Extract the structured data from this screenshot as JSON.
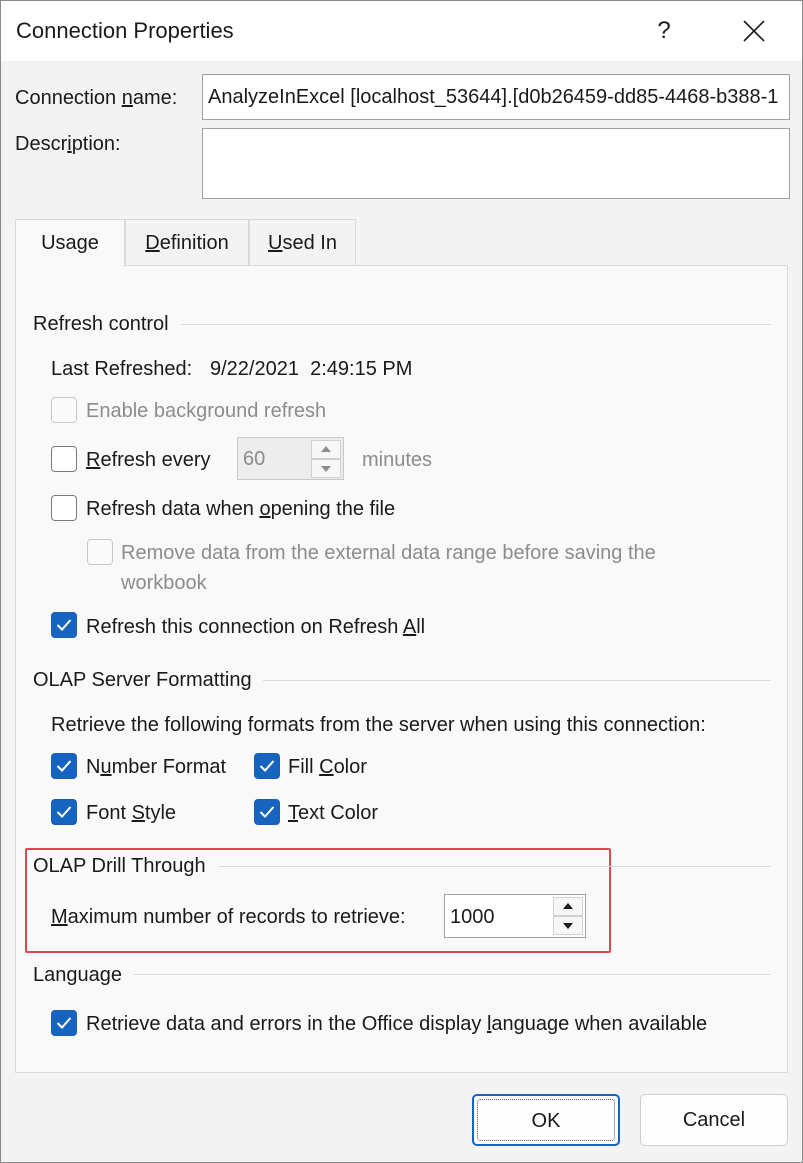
{
  "title": "Connection Properties",
  "titlebar": {
    "help_label": "?"
  },
  "fields": {
    "connection_name_label_pre": "Connection ",
    "connection_name_label_ul": "n",
    "connection_name_label_post": "ame:",
    "connection_name_value": "AnalyzeInExcel [localhost_53644].[d0b26459-dd85-4468-b388-1",
    "description_label_pre": "Descr",
    "description_label_ul": "i",
    "description_label_post": "ption:",
    "description_value": ""
  },
  "tabs": {
    "usage": "Usage",
    "definition_ul": "D",
    "definition_rest": "efinition",
    "used_in_ul": "U",
    "used_in_rest": "sed In"
  },
  "refresh_control": {
    "heading": "Refresh control",
    "last_refreshed_label": "Last Refreshed:",
    "last_refreshed_value": "9/22/2021  2:49:15 PM",
    "enable_background": "Enable background refresh",
    "refresh_every_ul": "R",
    "refresh_every_rest": "efresh every",
    "refresh_every_value": "60",
    "minutes": "minutes",
    "refresh_on_open_pre": "Refresh data when ",
    "refresh_on_open_ul": "o",
    "refresh_on_open_post": "pening the file",
    "remove_data_line1": "Remove data from the external data range before saving the",
    "remove_data_line2": "workbook",
    "refresh_all_pre": "Refresh this connection on Refresh ",
    "refresh_all_ul": "A",
    "refresh_all_post": "ll"
  },
  "olap_formatting": {
    "heading": "OLAP Server Formatting",
    "description": "Retrieve the following formats from the server when using this connection:",
    "number_format_pre": "N",
    "number_format_ul": "u",
    "number_format_post": "mber Format",
    "fill_color_pre": "Fill ",
    "fill_color_ul": "C",
    "fill_color_post": "olor",
    "font_style_pre": "Font ",
    "font_style_ul": "S",
    "font_style_post": "tyle",
    "text_color_ul": "T",
    "text_color_post": "ext Color"
  },
  "olap_drill": {
    "heading": "OLAP Drill Through",
    "max_records_ul": "M",
    "max_records_rest": "aximum number of records to retrieve:",
    "max_records_value": "1000"
  },
  "language": {
    "heading": "Language",
    "retrieve_pre": "Retrieve data and errors in the Office display ",
    "retrieve_ul": "l",
    "retrieve_post": "anguage when available"
  },
  "buttons": {
    "ok": "OK",
    "cancel": "Cancel"
  },
  "colors": {
    "accent": "#1565c0",
    "highlight_border": "#e0484f"
  }
}
